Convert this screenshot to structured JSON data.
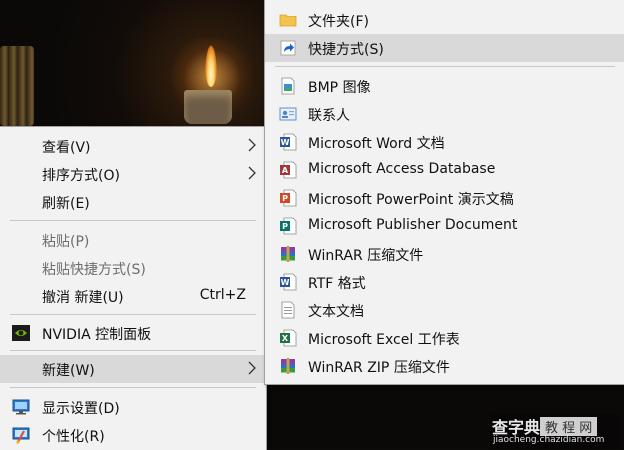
{
  "main_menu": {
    "items": [
      {
        "label": "查看(V)"
      },
      {
        "label": "排序方式(O)"
      },
      {
        "label": "刷新(E)"
      },
      {
        "label": "粘贴(P)"
      },
      {
        "label": "粘贴快捷方式(S)"
      },
      {
        "label": "撤消 新建(U)",
        "accel": "Ctrl+Z"
      },
      {
        "label": "NVIDIA 控制面板"
      },
      {
        "label": "新建(W)"
      },
      {
        "label": "显示设置(D)"
      },
      {
        "label": "个性化(R)"
      }
    ]
  },
  "sub_menu": {
    "items": [
      {
        "label": "文件夹(F)"
      },
      {
        "label": "快捷方式(S)"
      },
      {
        "label": "BMP 图像"
      },
      {
        "label": "联系人"
      },
      {
        "label": "Microsoft Word 文档"
      },
      {
        "label": "Microsoft Access Database"
      },
      {
        "label": "Microsoft PowerPoint 演示文稿"
      },
      {
        "label": "Microsoft Publisher Document"
      },
      {
        "label": "WinRAR 压缩文件"
      },
      {
        "label": "RTF 格式"
      },
      {
        "label": "文本文档"
      },
      {
        "label": "Microsoft Excel 工作表"
      },
      {
        "label": "WinRAR ZIP 压缩文件"
      }
    ]
  },
  "watermark": {
    "line1": "查字典",
    "line2": "教 程 网",
    "line3": "jiaocheng.chazidian.com"
  }
}
